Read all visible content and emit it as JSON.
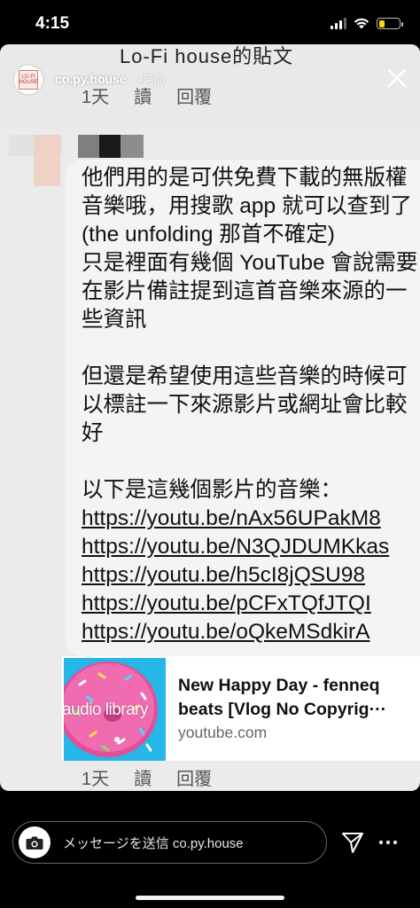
{
  "status_bar": {
    "time": "4:15"
  },
  "story": {
    "username": "co.py.house",
    "time_ago": "4時間",
    "avatar_text": "LO·FI HOUSE",
    "cut_title": "Lo-Fi house的貼文",
    "meta_top": {
      "age": "1天",
      "read": "讀",
      "reply": "回覆"
    },
    "meta_bottom": {
      "age": "1天",
      "read": "讀",
      "reply": "回覆"
    },
    "comment": {
      "lines": [
        "他們用的是可供免費下載的無版權",
        "音樂哦，用搜歌 app 就可以查到了",
        "(the unfolding 那首不確定)",
        "只是裡面有幾個 YouTube 會說需要",
        "在影片備註提到這首音樂來源的一",
        "些資訊"
      ],
      "lines2": [
        "但還是希望使用這些音樂的時候可",
        "以標註一下來源影片或網址會比較",
        "好"
      ],
      "intro": "以下是這幾個影片的音樂：",
      "urls": [
        "https://youtu.be/nAx56UPakM8",
        "https://youtu.be/N3QJDUMKkas",
        "https://youtu.be/h5cI8jQSU98",
        "https://youtu.be/pCFxTQfJTQI",
        "https://youtu.be/oQkeMSdkirA"
      ]
    },
    "link_preview": {
      "thumb_label": "audio library",
      "title_line1": "New Happy Day - fenneq",
      "title_line2": "beats [Vlog No Copyrig···",
      "host": "youtube.com"
    }
  },
  "bottom_bar": {
    "message_placeholder": "メッセージを送信 co.py.house"
  },
  "colors": {
    "background": "#000000",
    "story_bg": "#ebebeb",
    "bubble": "#f4f4f4",
    "thumb_blue": "#26b6e8",
    "donut_pink": "#f06bb0"
  }
}
